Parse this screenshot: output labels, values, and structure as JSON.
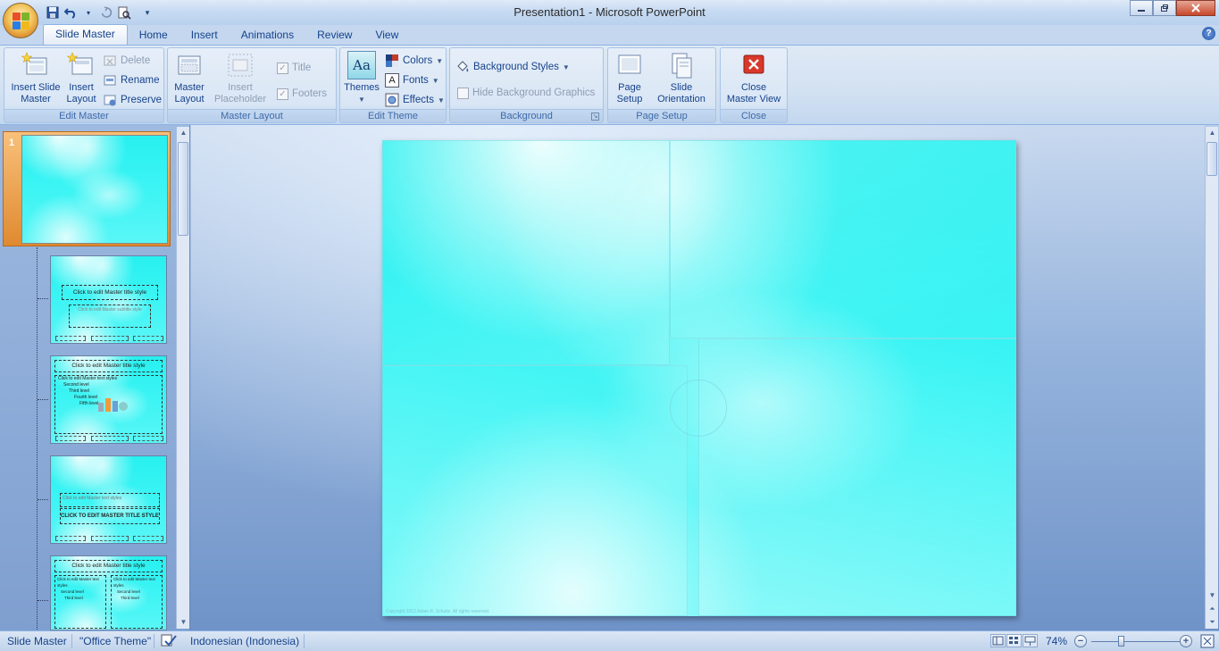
{
  "window": {
    "title": "Presentation1 - Microsoft PowerPoint"
  },
  "quick_access": [
    {
      "name": "save-icon",
      "glyph": "💾"
    },
    {
      "name": "undo-icon",
      "glyph": "↶"
    },
    {
      "name": "dropdown-icon",
      "glyph": "▾"
    },
    {
      "name": "redo-icon",
      "glyph": "↻"
    },
    {
      "name": "print-preview-icon",
      "glyph": "🔍"
    },
    {
      "name": "customize-qat-icon",
      "glyph": "▾"
    }
  ],
  "tabs": [
    {
      "label": "Slide Master",
      "active": true
    },
    {
      "label": "Home",
      "active": false
    },
    {
      "label": "Insert",
      "active": false
    },
    {
      "label": "Animations",
      "active": false
    },
    {
      "label": "Review",
      "active": false
    },
    {
      "label": "View",
      "active": false
    }
  ],
  "ribbon": {
    "edit_master": {
      "label": "Edit Master",
      "insert_slide_master": "Insert Slide\nMaster",
      "insert_layout": "Insert\nLayout",
      "delete": "Delete",
      "rename": "Rename",
      "preserve": "Preserve"
    },
    "master_layout": {
      "label": "Master Layout",
      "master_layout_btn": "Master\nLayout",
      "insert_placeholder": "Insert\nPlaceholder",
      "title": "Title",
      "footers": "Footers"
    },
    "edit_theme": {
      "label": "Edit Theme",
      "themes": "Themes",
      "themes_icon_text": "Aa",
      "colors": "Colors",
      "fonts": "Fonts",
      "effects": "Effects"
    },
    "background": {
      "label": "Background",
      "background_styles": "Background Styles",
      "hide_background_graphics": "Hide Background Graphics"
    },
    "page_setup": {
      "label": "Page Setup",
      "page_setup_btn": "Page\nSetup",
      "slide_orientation": "Slide\nOrientation"
    },
    "close": {
      "label": "Close",
      "close_master_view": "Close\nMaster View"
    }
  },
  "thumbnails": {
    "master_number": "1",
    "layouts": [
      {
        "title": "Click to edit Master title style",
        "subtitle": "Click to edit Master subtitle style"
      },
      {
        "title": "Click to edit Master title style",
        "body": "Click to edit Master text styles",
        "level2": "Second level",
        "level3": "Third level",
        "level4": "Fourth level",
        "level5": "Fifth level"
      },
      {
        "title": "CLICK TO EDIT MASTER TITLE STYLE",
        "body": "Click to edit Master text styles"
      },
      {
        "title": "Click to edit Master title style",
        "body_left": "Click to edit Master text styles",
        "body_right": "Click to edit Master text styles",
        "level2": "Second level",
        "level3": "Third level"
      }
    ]
  },
  "slide": {
    "copyright": "Copyright 2012 Adam R. Schultz. All rights reserved."
  },
  "status": {
    "view": "Slide Master",
    "theme": "\"Office Theme\"",
    "language": "Indonesian (Indonesia)",
    "zoom": "74%",
    "zoom_fraction": 0.74
  },
  "colors": {
    "accent": "#15428b",
    "slide": "#3df4f4",
    "selected_thumb": "#e08a30"
  }
}
